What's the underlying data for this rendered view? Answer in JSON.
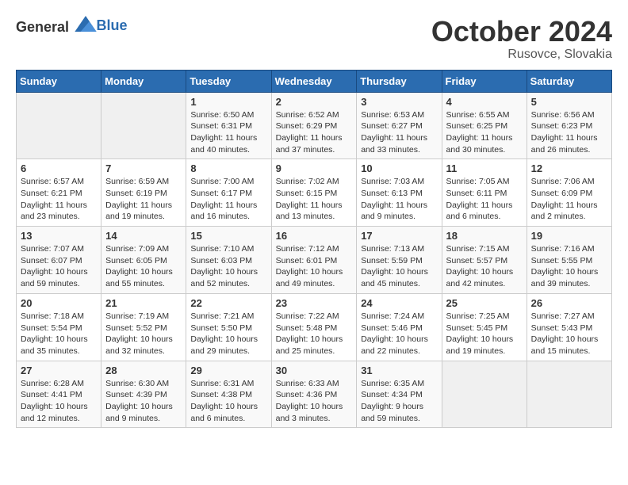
{
  "header": {
    "logo_general": "General",
    "logo_blue": "Blue",
    "month": "October 2024",
    "location": "Rusovce, Slovakia"
  },
  "weekdays": [
    "Sunday",
    "Monday",
    "Tuesday",
    "Wednesday",
    "Thursday",
    "Friday",
    "Saturday"
  ],
  "weeks": [
    [
      {
        "day": "",
        "empty": true
      },
      {
        "day": "",
        "empty": true
      },
      {
        "day": "1",
        "sunrise": "Sunrise: 6:50 AM",
        "sunset": "Sunset: 6:31 PM",
        "daylight": "Daylight: 11 hours and 40 minutes."
      },
      {
        "day": "2",
        "sunrise": "Sunrise: 6:52 AM",
        "sunset": "Sunset: 6:29 PM",
        "daylight": "Daylight: 11 hours and 37 minutes."
      },
      {
        "day": "3",
        "sunrise": "Sunrise: 6:53 AM",
        "sunset": "Sunset: 6:27 PM",
        "daylight": "Daylight: 11 hours and 33 minutes."
      },
      {
        "day": "4",
        "sunrise": "Sunrise: 6:55 AM",
        "sunset": "Sunset: 6:25 PM",
        "daylight": "Daylight: 11 hours and 30 minutes."
      },
      {
        "day": "5",
        "sunrise": "Sunrise: 6:56 AM",
        "sunset": "Sunset: 6:23 PM",
        "daylight": "Daylight: 11 hours and 26 minutes."
      }
    ],
    [
      {
        "day": "6",
        "sunrise": "Sunrise: 6:57 AM",
        "sunset": "Sunset: 6:21 PM",
        "daylight": "Daylight: 11 hours and 23 minutes."
      },
      {
        "day": "7",
        "sunrise": "Sunrise: 6:59 AM",
        "sunset": "Sunset: 6:19 PM",
        "daylight": "Daylight: 11 hours and 19 minutes."
      },
      {
        "day": "8",
        "sunrise": "Sunrise: 7:00 AM",
        "sunset": "Sunset: 6:17 PM",
        "daylight": "Daylight: 11 hours and 16 minutes."
      },
      {
        "day": "9",
        "sunrise": "Sunrise: 7:02 AM",
        "sunset": "Sunset: 6:15 PM",
        "daylight": "Daylight: 11 hours and 13 minutes."
      },
      {
        "day": "10",
        "sunrise": "Sunrise: 7:03 AM",
        "sunset": "Sunset: 6:13 PM",
        "daylight": "Daylight: 11 hours and 9 minutes."
      },
      {
        "day": "11",
        "sunrise": "Sunrise: 7:05 AM",
        "sunset": "Sunset: 6:11 PM",
        "daylight": "Daylight: 11 hours and 6 minutes."
      },
      {
        "day": "12",
        "sunrise": "Sunrise: 7:06 AM",
        "sunset": "Sunset: 6:09 PM",
        "daylight": "Daylight: 11 hours and 2 minutes."
      }
    ],
    [
      {
        "day": "13",
        "sunrise": "Sunrise: 7:07 AM",
        "sunset": "Sunset: 6:07 PM",
        "daylight": "Daylight: 10 hours and 59 minutes."
      },
      {
        "day": "14",
        "sunrise": "Sunrise: 7:09 AM",
        "sunset": "Sunset: 6:05 PM",
        "daylight": "Daylight: 10 hours and 55 minutes."
      },
      {
        "day": "15",
        "sunrise": "Sunrise: 7:10 AM",
        "sunset": "Sunset: 6:03 PM",
        "daylight": "Daylight: 10 hours and 52 minutes."
      },
      {
        "day": "16",
        "sunrise": "Sunrise: 7:12 AM",
        "sunset": "Sunset: 6:01 PM",
        "daylight": "Daylight: 10 hours and 49 minutes."
      },
      {
        "day": "17",
        "sunrise": "Sunrise: 7:13 AM",
        "sunset": "Sunset: 5:59 PM",
        "daylight": "Daylight: 10 hours and 45 minutes."
      },
      {
        "day": "18",
        "sunrise": "Sunrise: 7:15 AM",
        "sunset": "Sunset: 5:57 PM",
        "daylight": "Daylight: 10 hours and 42 minutes."
      },
      {
        "day": "19",
        "sunrise": "Sunrise: 7:16 AM",
        "sunset": "Sunset: 5:55 PM",
        "daylight": "Daylight: 10 hours and 39 minutes."
      }
    ],
    [
      {
        "day": "20",
        "sunrise": "Sunrise: 7:18 AM",
        "sunset": "Sunset: 5:54 PM",
        "daylight": "Daylight: 10 hours and 35 minutes."
      },
      {
        "day": "21",
        "sunrise": "Sunrise: 7:19 AM",
        "sunset": "Sunset: 5:52 PM",
        "daylight": "Daylight: 10 hours and 32 minutes."
      },
      {
        "day": "22",
        "sunrise": "Sunrise: 7:21 AM",
        "sunset": "Sunset: 5:50 PM",
        "daylight": "Daylight: 10 hours and 29 minutes."
      },
      {
        "day": "23",
        "sunrise": "Sunrise: 7:22 AM",
        "sunset": "Sunset: 5:48 PM",
        "daylight": "Daylight: 10 hours and 25 minutes."
      },
      {
        "day": "24",
        "sunrise": "Sunrise: 7:24 AM",
        "sunset": "Sunset: 5:46 PM",
        "daylight": "Daylight: 10 hours and 22 minutes."
      },
      {
        "day": "25",
        "sunrise": "Sunrise: 7:25 AM",
        "sunset": "Sunset: 5:45 PM",
        "daylight": "Daylight: 10 hours and 19 minutes."
      },
      {
        "day": "26",
        "sunrise": "Sunrise: 7:27 AM",
        "sunset": "Sunset: 5:43 PM",
        "daylight": "Daylight: 10 hours and 15 minutes."
      }
    ],
    [
      {
        "day": "27",
        "sunrise": "Sunrise: 6:28 AM",
        "sunset": "Sunset: 4:41 PM",
        "daylight": "Daylight: 10 hours and 12 minutes."
      },
      {
        "day": "28",
        "sunrise": "Sunrise: 6:30 AM",
        "sunset": "Sunset: 4:39 PM",
        "daylight": "Daylight: 10 hours and 9 minutes."
      },
      {
        "day": "29",
        "sunrise": "Sunrise: 6:31 AM",
        "sunset": "Sunset: 4:38 PM",
        "daylight": "Daylight: 10 hours and 6 minutes."
      },
      {
        "day": "30",
        "sunrise": "Sunrise: 6:33 AM",
        "sunset": "Sunset: 4:36 PM",
        "daylight": "Daylight: 10 hours and 3 minutes."
      },
      {
        "day": "31",
        "sunrise": "Sunrise: 6:35 AM",
        "sunset": "Sunset: 4:34 PM",
        "daylight": "Daylight: 9 hours and 59 minutes."
      },
      {
        "day": "",
        "empty": true
      },
      {
        "day": "",
        "empty": true
      }
    ]
  ]
}
